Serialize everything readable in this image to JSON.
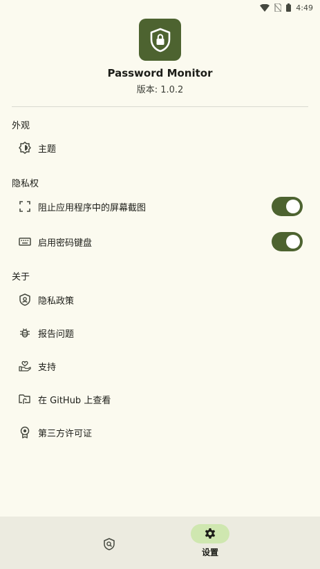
{
  "status_bar": {
    "time": "4:49",
    "icons": [
      "wifi-icon",
      "no-sim-icon",
      "battery-icon"
    ]
  },
  "app": {
    "icon": "shield-lock-icon",
    "name": "Password Monitor",
    "version": "版本: 1.0.2",
    "accent_color": "#4d6330"
  },
  "sections": {
    "appearance": {
      "title": "外观",
      "items": [
        {
          "icon": "theme-icon",
          "label": "主题"
        }
      ]
    },
    "privacy": {
      "title": "隐私权",
      "items": [
        {
          "icon": "screenshot-icon",
          "label": "阻止应用程序中的屏幕截图",
          "toggle": true
        },
        {
          "icon": "keyboard-icon",
          "label": "启用密码键盘",
          "toggle": true
        }
      ]
    },
    "about": {
      "title": "关于",
      "items": [
        {
          "icon": "privacy-policy-icon",
          "label": "隐私政策"
        },
        {
          "icon": "bug-icon",
          "label": "报告问题"
        },
        {
          "icon": "support-icon",
          "label": "支持"
        },
        {
          "icon": "github-icon",
          "label": "在 GitHub 上查看"
        },
        {
          "icon": "license-icon",
          "label": "第三方许可证"
        }
      ]
    }
  },
  "bottom_nav": {
    "items": [
      {
        "icon": "shield-search-icon",
        "label": "",
        "active": false
      },
      {
        "icon": "gear-icon",
        "label": "设置",
        "active": true
      }
    ]
  }
}
